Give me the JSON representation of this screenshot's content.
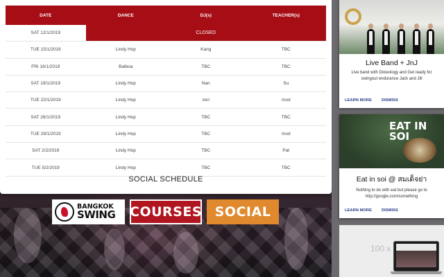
{
  "schedule": {
    "columns": [
      "DATE",
      "DANCE",
      "DJ(s)",
      "TEACHER(s)"
    ],
    "closed_row": {
      "date": "SAT 12/1/2019",
      "label": "CLOSED"
    },
    "rows": [
      {
        "date": "TUE 15/1/2019",
        "dance": "Lindy Hop",
        "dj": "Kang",
        "teacher": "TBC"
      },
      {
        "date": "FRI 18/1/2019",
        "dance": "Balboa",
        "dj": "TBC",
        "teacher": "TBC"
      },
      {
        "date": "SAT 19/1/2019",
        "dance": "Lindy Hop",
        "dj": "Nan",
        "teacher": "Su"
      },
      {
        "date": "TUE 22/1/2019",
        "dance": "Lindy Hop",
        "dj": "zen",
        "teacher": "mod"
      },
      {
        "date": "SAT 26/1/2019",
        "dance": "Lindy Hop",
        "dj": "TBC",
        "teacher": "TBC"
      },
      {
        "date": "TUE 29/1/2019",
        "dance": "Lindy Hop",
        "dj": "TBC",
        "teacher": "mod"
      },
      {
        "date": "SAT 2/2/2019",
        "dance": "Lindy Hop",
        "dj": "TBC",
        "teacher": "Pat"
      },
      {
        "date": "TUE 5/2/2019",
        "dance": "Lindy Hop",
        "dj": "TBC",
        "teacher": "TBC"
      }
    ],
    "caption": "SOCIAL SCHEDULE"
  },
  "nav": {
    "logo_line1": "BANGKOK",
    "logo_line2": "SWING",
    "courses_label": "COURSES",
    "social_label": "SOCIAL"
  },
  "cards": [
    {
      "title": "Live Band + JnJ",
      "description": "Live band with Dixieology and Get ready for swingout endurance Jack and Jill",
      "learn_more": "LEARN MORE",
      "dismiss": "DISMISS"
    },
    {
      "image_title_line1": "EAT IN",
      "image_title_line2": "SOI",
      "title": "Eat in soi @ สมเด็จย่า",
      "description": "Nothing to do with eat but please go to http://google.com/something",
      "learn_more": "LEARN MORE",
      "dismiss": "DISMISS"
    }
  ],
  "ad": {
    "text": "100 x"
  },
  "colors": {
    "brand_red": "#a60d15",
    "social_orange": "#e0892e",
    "link_blue": "#2a3f8c"
  }
}
